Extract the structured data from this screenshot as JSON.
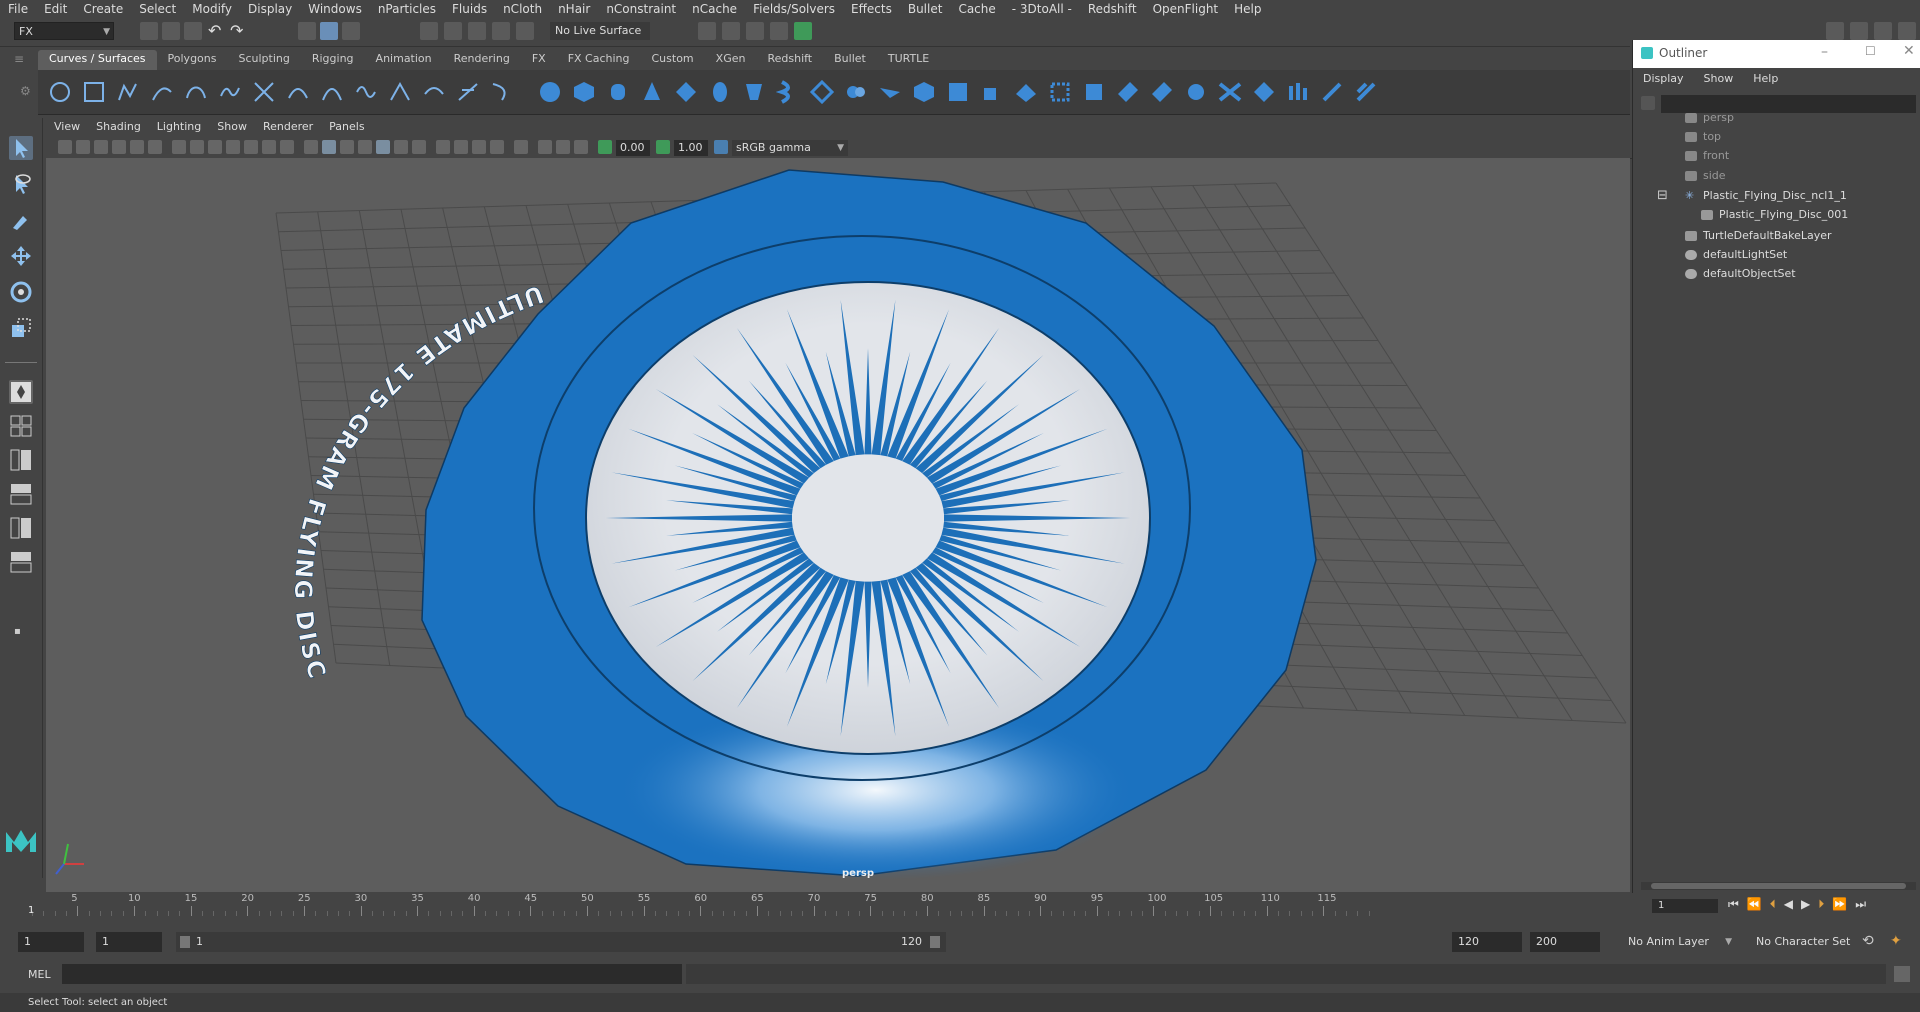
{
  "menubar": [
    "File",
    "Edit",
    "Create",
    "Select",
    "Modify",
    "Display",
    "Windows",
    "nParticles",
    "Fluids",
    "nCloth",
    "nHair",
    "nConstraint",
    "nCache",
    "Fields/Solvers",
    "Effects",
    "Bullet",
    "Cache",
    "- 3DtoAll -",
    "Redshift",
    "OpenFlight",
    "Help"
  ],
  "statusline": {
    "mode": "FX",
    "live_surface": "No Live Surface"
  },
  "shelf_tabs": [
    "Curves / Surfaces",
    "Polygons",
    "Sculpting",
    "Rigging",
    "Animation",
    "Rendering",
    "FX",
    "FX Caching",
    "Custom",
    "XGen",
    "Redshift",
    "Bullet",
    "TURTLE"
  ],
  "panel_menu": [
    "View",
    "Shading",
    "Lighting",
    "Show",
    "Renderer",
    "Panels"
  ],
  "panel_toolbar": {
    "exposure": "0.00",
    "gamma": "1.00",
    "colorspace": "sRGB gamma"
  },
  "viewport": {
    "camera_label": "persp",
    "disc_text": "ULTIMATE 175-GRAM FLYING DISC",
    "colors": {
      "disc_blue": "#1b72c0",
      "label_bg": "#dfe3ea",
      "rays": "#1d6fb8",
      "grid_bg": "#5d5d5d"
    }
  },
  "outliner": {
    "title": "Outliner",
    "menu": [
      "Display",
      "Show",
      "Help"
    ],
    "items": [
      {
        "label": "persp",
        "type": "camera"
      },
      {
        "label": "top",
        "type": "camera"
      },
      {
        "label": "front",
        "type": "camera"
      },
      {
        "label": "side",
        "type": "camera"
      },
      {
        "label": "Plastic_Flying_Disc_ncl1_1",
        "type": "group"
      },
      {
        "label": "Plastic_Flying_Disc_001",
        "type": "mesh"
      },
      {
        "label": "TurtleDefaultBakeLayer",
        "type": "node"
      },
      {
        "label": "defaultLightSet",
        "type": "set"
      },
      {
        "label": "defaultObjectSet",
        "type": "set"
      }
    ]
  },
  "timeline": {
    "ticks": [
      "5",
      "10",
      "15",
      "20",
      "25",
      "30",
      "35",
      "40",
      "45",
      "50",
      "55",
      "60",
      "65",
      "70",
      "75",
      "80",
      "85",
      "90",
      "95",
      "100",
      "105",
      "110",
      "115"
    ],
    "current_frame_marker": "1",
    "current_frame_field": "1"
  },
  "range": {
    "start": "1",
    "playback_start": "1",
    "slider_start": "1",
    "slider_end": "120",
    "playback_end": "120",
    "end": "200",
    "anim_layer": "No Anim Layer",
    "character_set": "No Character Set"
  },
  "cmdline": {
    "lang": "MEL"
  },
  "helpline": "Select Tool: select an object"
}
